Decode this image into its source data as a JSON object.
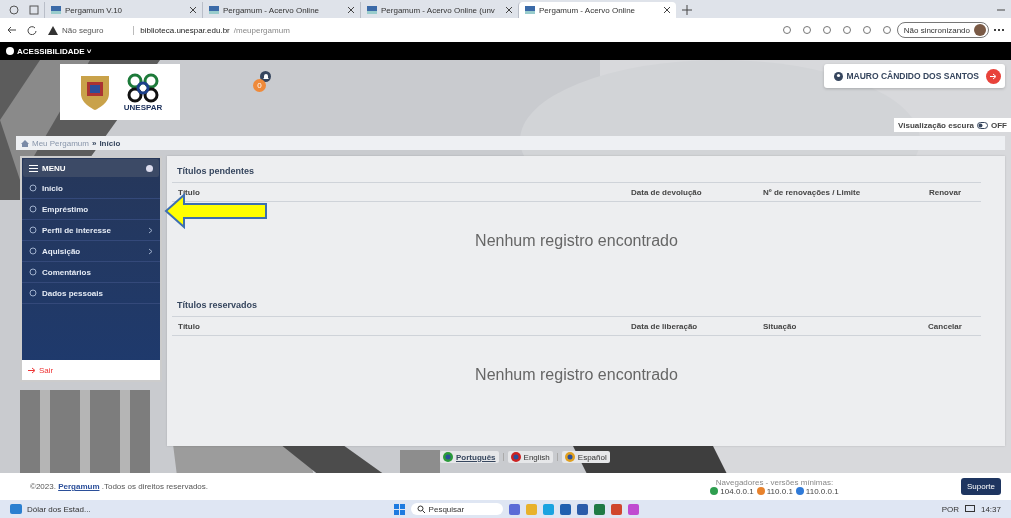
{
  "browser": {
    "tabs": [
      {
        "label": "Pergamum V.10",
        "selected": false
      },
      {
        "label": "Pergamum - Acervo Online",
        "selected": false
      },
      {
        "label": "Pergamum - Acervo Online (unv",
        "selected": false
      },
      {
        "label": "Pergamum - Acervo Online",
        "selected": true
      }
    ],
    "security": "Não seguro",
    "url_host": "biblioteca.unespar.edu.br",
    "url_path": "/meupergamum",
    "sync": "Não sincronizando"
  },
  "accessibility": "ACESSIBILIDADE ˅",
  "header": {
    "logo_text": "UNESPAR",
    "notifications": "0",
    "user": "MAURO CÂNDIDO DOS SANTOS",
    "dark_mode": {
      "label": "Visualização escura",
      "on": false,
      "state": "OFF"
    }
  },
  "breadcrumb": {
    "home": "Meu Pergamum",
    "separator": "»",
    "current": "Início"
  },
  "menu": {
    "title": "MENU",
    "items": [
      {
        "label": "Início",
        "has_submenu": false
      },
      {
        "label": "Empréstimo",
        "has_submenu": false
      },
      {
        "label": "Perfil de interesse",
        "has_submenu": true
      },
      {
        "label": "Aquisição",
        "has_submenu": true
      },
      {
        "label": "Comentários",
        "has_submenu": false
      },
      {
        "label": "Dados pessoais",
        "has_submenu": false
      }
    ],
    "logout": "Sair"
  },
  "sections": [
    {
      "title": "Títulos pendentes",
      "columns": [
        "Título",
        "Data de devolução",
        "Nº de renovações / Limite",
        "Renovar"
      ],
      "empty": "Nenhum registro encontrado"
    },
    {
      "title": "Títulos reservados",
      "columns": [
        "Título",
        "Data de liberação",
        "Situação",
        "Cancelar"
      ],
      "empty": "Nenhum registro encontrado"
    }
  ],
  "languages": [
    {
      "label": "Português",
      "selected": true
    },
    {
      "label": "English",
      "selected": false
    },
    {
      "label": "Español",
      "selected": false
    }
  ],
  "footer": {
    "copyright": "©2023.",
    "brand": "Pergamum",
    "rights": ".Todos os direitos reservados.",
    "browsers_label": "Navegadores - versões mínimas:",
    "versions": [
      "104.0.0.1",
      "110.0.1",
      "110.0.0.1"
    ],
    "support": "Suporte"
  },
  "taskbar": {
    "widget": "Dólar dos Estad...",
    "search": "Pesquisar",
    "language": "POR",
    "time": "14:37"
  }
}
